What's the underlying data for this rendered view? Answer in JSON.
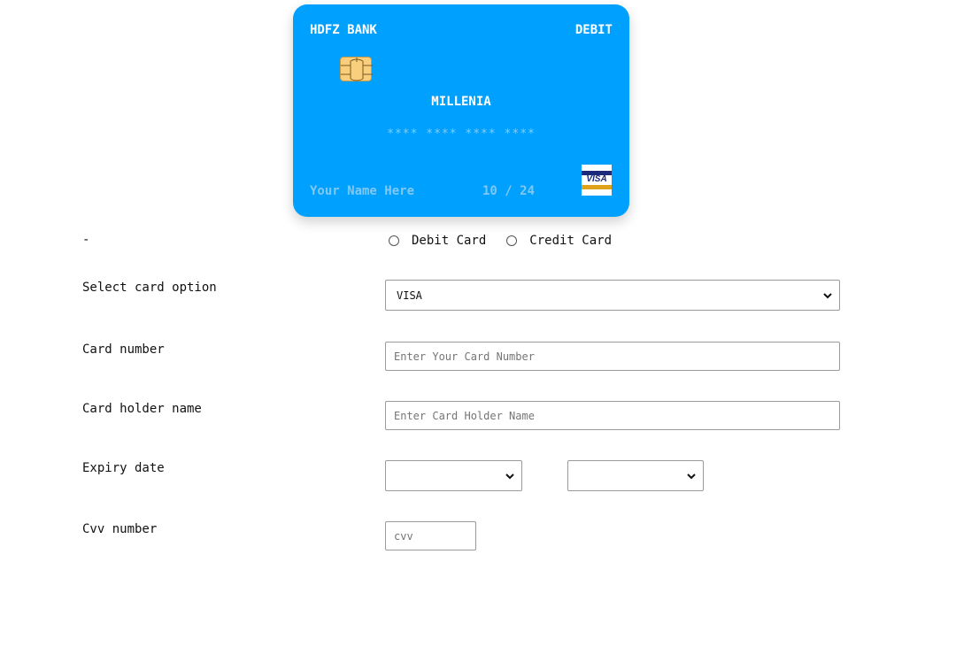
{
  "card": {
    "bank": "HDFZ BANK",
    "type": "DEBIT",
    "variant": "MILLENIA",
    "number_mask": "**** **** **** ****",
    "holder": "Your Name Here",
    "expiry": "10 / 24",
    "network_logo_text": "VISA",
    "background_color": "#00a0ff"
  },
  "form": {
    "card_kind_label": "-",
    "card_kind_options": [
      "Debit Card",
      "Credit Card"
    ],
    "select_option_label": "Select card option",
    "select_option_value": "VISA",
    "card_number_label": "Card number",
    "card_number_placeholder": "Enter Your Card Number",
    "holder_label": "Card holder name",
    "holder_placeholder": "Enter Card Holder Name",
    "expiry_label": "Expiry date",
    "expiry_month_value": "",
    "expiry_year_value": "",
    "cvv_label": "Cvv number",
    "cvv_placeholder": "cvv"
  }
}
